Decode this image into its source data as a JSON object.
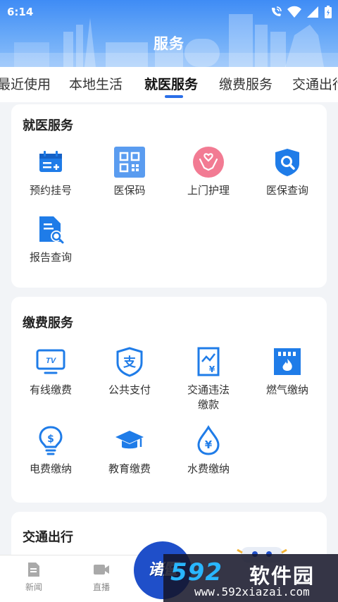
{
  "status_bar": {
    "time": "6:14"
  },
  "header": {
    "title": "服务"
  },
  "tabs": [
    {
      "label": "最近使用"
    },
    {
      "label": "本地生活"
    },
    {
      "label": "就医服务"
    },
    {
      "label": "缴费服务"
    },
    {
      "label": "交通出行"
    }
  ],
  "active_tab": "就医服务",
  "sections": {
    "medical": {
      "title": "就医服务",
      "items": [
        {
          "label": "预约挂号",
          "icon": "calendar-icon"
        },
        {
          "label": "医保码",
          "icon": "qr-code-icon"
        },
        {
          "label": "上门护理",
          "icon": "care-hands-icon"
        },
        {
          "label": "医保查询",
          "icon": "shield-search-icon"
        },
        {
          "label": "报告查询",
          "icon": "report-search-icon"
        }
      ]
    },
    "payment": {
      "title": "缴费服务",
      "items": [
        {
          "label": "有线缴费",
          "icon": "tv-icon"
        },
        {
          "label": "公共支付",
          "icon": "alipay-shield-icon"
        },
        {
          "label": "交通违法缴款",
          "icon": "traffic-fine-icon"
        },
        {
          "label": "燃气缴纳",
          "icon": "gas-meter-icon"
        },
        {
          "label": "电费缴纳",
          "icon": "lightbulb-icon"
        },
        {
          "label": "教育缴费",
          "icon": "graduation-cap-icon"
        },
        {
          "label": "水费缴纳",
          "icon": "water-drop-icon"
        }
      ]
    },
    "traffic": {
      "title": "交通出行"
    }
  },
  "bottom_nav": [
    {
      "label": "新闻",
      "icon": "news-icon"
    },
    {
      "label": "直播",
      "icon": "video-icon"
    }
  ],
  "center_badge": {
    "text": "诸暨"
  },
  "watermark": {
    "logo": "592",
    "name": "软件园",
    "url": "www.592xiazai.com"
  },
  "colors": {
    "accent": "#2a6fe8",
    "header_top": "#3f8cf5",
    "icon_blue": "#1f7ce8",
    "icon_pink": "#f27b93"
  }
}
